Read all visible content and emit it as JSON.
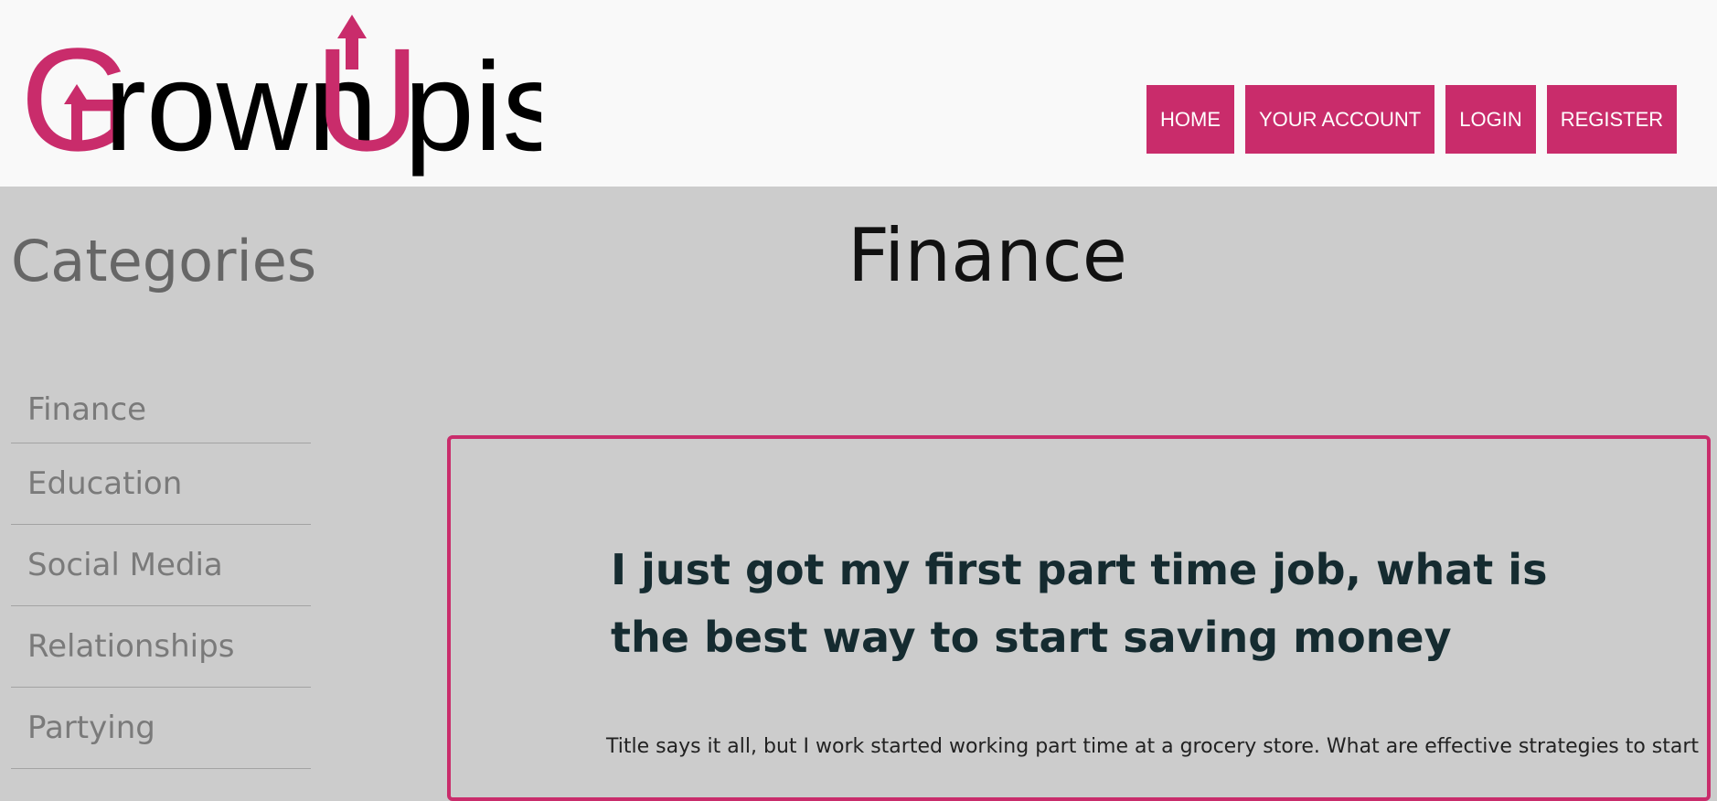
{
  "header": {
    "logo_text_part1": "Grown",
    "logo_text_part2": "Upish",
    "nav": [
      {
        "label": "HOME"
      },
      {
        "label": "YOUR ACCOUNT"
      },
      {
        "label": "LOGIN"
      },
      {
        "label": "REGISTER"
      }
    ]
  },
  "sidebar": {
    "title": "Categories",
    "items": [
      {
        "label": "Finance"
      },
      {
        "label": "Education"
      },
      {
        "label": "Social Media"
      },
      {
        "label": "Relationships"
      },
      {
        "label": "Partying"
      }
    ]
  },
  "main": {
    "title": "Finance",
    "post": {
      "title": "I just got my first part time job, what is the best way to start saving money",
      "body": "Title says it all, but I work started working part time at a grocery store. What are effective strategies to start"
    }
  },
  "colors": {
    "accent": "#c92c6b",
    "header_bg": "#f9f9f9",
    "page_bg": "#cccccc"
  }
}
